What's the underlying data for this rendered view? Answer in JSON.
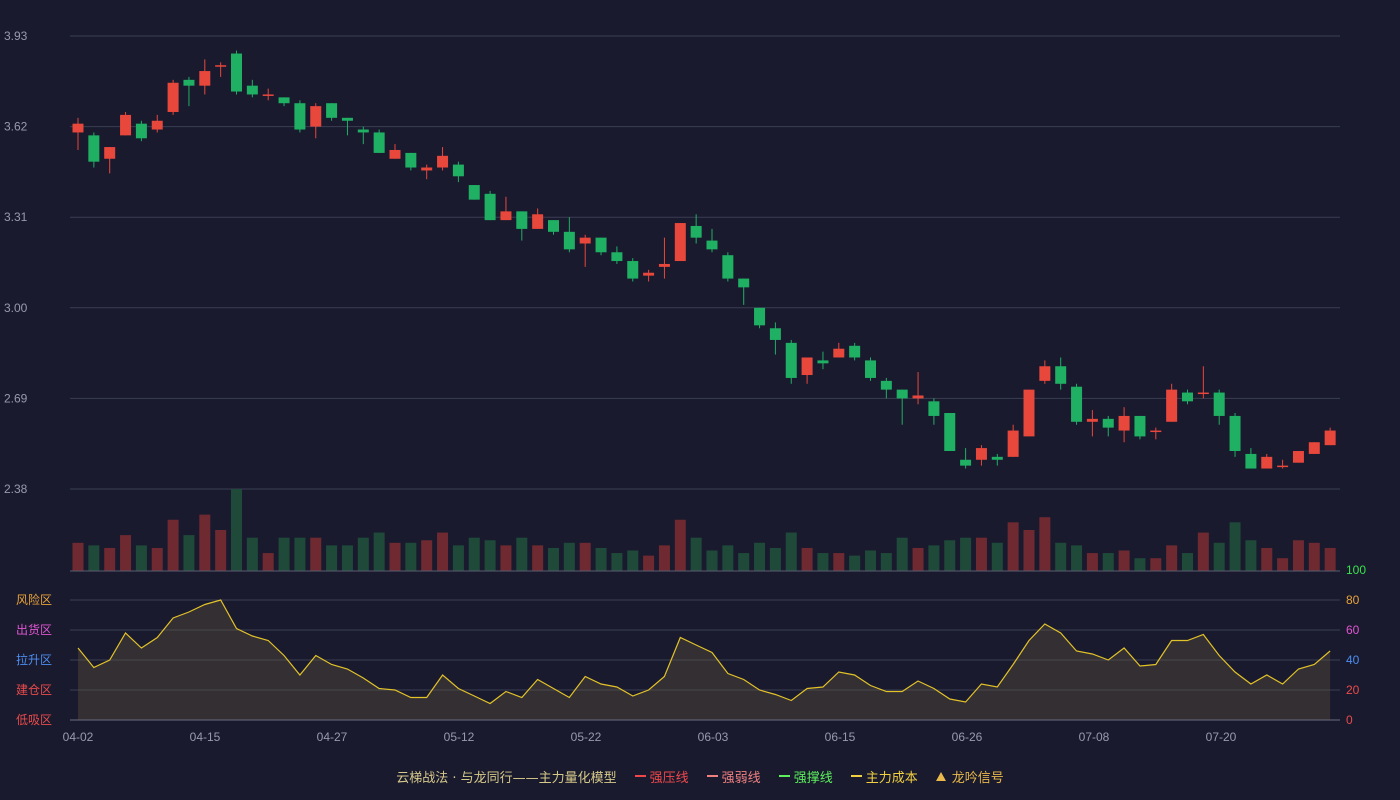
{
  "chart_data": [
    {
      "type": "candlestick",
      "ylim": [
        2.38,
        3.93
      ],
      "y_ticks": [
        "3.93",
        "3.62",
        "3.31",
        "3.00",
        "2.69",
        "2.38"
      ],
      "grid": true,
      "up_color": "#e8473c",
      "down_color": "#20b064",
      "ohlc": [
        [
          3.6,
          3.63,
          3.54,
          3.65
        ],
        [
          3.59,
          3.5,
          3.48,
          3.6
        ],
        [
          3.51,
          3.55,
          3.46,
          3.55
        ],
        [
          3.59,
          3.66,
          3.59,
          3.67
        ],
        [
          3.63,
          3.58,
          3.57,
          3.64
        ],
        [
          3.61,
          3.64,
          3.6,
          3.66
        ],
        [
          3.67,
          3.77,
          3.66,
          3.78
        ],
        [
          3.78,
          3.76,
          3.69,
          3.79
        ],
        [
          3.76,
          3.81,
          3.73,
          3.85
        ],
        [
          3.83,
          3.83,
          3.79,
          3.84
        ],
        [
          3.87,
          3.74,
          3.73,
          3.88
        ],
        [
          3.76,
          3.73,
          3.72,
          3.78
        ],
        [
          3.73,
          3.73,
          3.71,
          3.75
        ],
        [
          3.72,
          3.7,
          3.69,
          3.72
        ],
        [
          3.7,
          3.61,
          3.6,
          3.71
        ],
        [
          3.62,
          3.69,
          3.58,
          3.7
        ],
        [
          3.7,
          3.65,
          3.64,
          3.7
        ],
        [
          3.65,
          3.64,
          3.59,
          3.65
        ],
        [
          3.61,
          3.6,
          3.56,
          3.62
        ],
        [
          3.6,
          3.53,
          3.53,
          3.61
        ],
        [
          3.51,
          3.54,
          3.51,
          3.56
        ],
        [
          3.53,
          3.48,
          3.47,
          3.53
        ],
        [
          3.47,
          3.48,
          3.44,
          3.49
        ],
        [
          3.48,
          3.52,
          3.47,
          3.55
        ],
        [
          3.49,
          3.45,
          3.43,
          3.5
        ],
        [
          3.42,
          3.37,
          3.37,
          3.42
        ],
        [
          3.39,
          3.3,
          3.3,
          3.4
        ],
        [
          3.3,
          3.33,
          3.3,
          3.38
        ],
        [
          3.33,
          3.27,
          3.23,
          3.33
        ],
        [
          3.27,
          3.32,
          3.27,
          3.34
        ],
        [
          3.3,
          3.26,
          3.25,
          3.3
        ],
        [
          3.26,
          3.2,
          3.19,
          3.31
        ],
        [
          3.22,
          3.24,
          3.14,
          3.25
        ],
        [
          3.24,
          3.19,
          3.18,
          3.24
        ],
        [
          3.19,
          3.16,
          3.15,
          3.21
        ],
        [
          3.16,
          3.1,
          3.09,
          3.17
        ],
        [
          3.11,
          3.12,
          3.09,
          3.13
        ],
        [
          3.14,
          3.15,
          3.1,
          3.24
        ],
        [
          3.16,
          3.29,
          3.16,
          3.29
        ],
        [
          3.28,
          3.24,
          3.22,
          3.32
        ],
        [
          3.23,
          3.2,
          3.19,
          3.27
        ],
        [
          3.18,
          3.1,
          3.09,
          3.19
        ],
        [
          3.1,
          3.07,
          3.01,
          3.1
        ],
        [
          3.0,
          2.94,
          2.93,
          3.0
        ],
        [
          2.93,
          2.89,
          2.84,
          2.95
        ],
        [
          2.88,
          2.76,
          2.74,
          2.89
        ],
        [
          2.77,
          2.83,
          2.74,
          2.83
        ],
        [
          2.82,
          2.81,
          2.79,
          2.85
        ],
        [
          2.83,
          2.86,
          2.83,
          2.88
        ],
        [
          2.87,
          2.83,
          2.82,
          2.88
        ],
        [
          2.82,
          2.76,
          2.75,
          2.83
        ],
        [
          2.75,
          2.72,
          2.69,
          2.76
        ],
        [
          2.72,
          2.69,
          2.6,
          2.72
        ],
        [
          2.69,
          2.7,
          2.67,
          2.78
        ],
        [
          2.68,
          2.63,
          2.6,
          2.69
        ],
        [
          2.64,
          2.51,
          2.51,
          2.64
        ],
        [
          2.48,
          2.46,
          2.45,
          2.52
        ],
        [
          2.48,
          2.52,
          2.46,
          2.53
        ],
        [
          2.49,
          2.48,
          2.46,
          2.5
        ],
        [
          2.49,
          2.58,
          2.49,
          2.6
        ],
        [
          2.56,
          2.72,
          2.56,
          2.72
        ],
        [
          2.75,
          2.8,
          2.74,
          2.82
        ],
        [
          2.8,
          2.74,
          2.72,
          2.83
        ],
        [
          2.73,
          2.61,
          2.6,
          2.74
        ],
        [
          2.61,
          2.62,
          2.56,
          2.65
        ],
        [
          2.62,
          2.59,
          2.56,
          2.63
        ],
        [
          2.58,
          2.63,
          2.54,
          2.66
        ],
        [
          2.63,
          2.56,
          2.55,
          2.63
        ],
        [
          2.58,
          2.58,
          2.55,
          2.59
        ],
        [
          2.61,
          2.72,
          2.61,
          2.74
        ],
        [
          2.71,
          2.68,
          2.67,
          2.72
        ],
        [
          2.71,
          2.71,
          2.69,
          2.8
        ],
        [
          2.71,
          2.63,
          2.6,
          2.72
        ],
        [
          2.63,
          2.51,
          2.49,
          2.64
        ],
        [
          2.5,
          2.45,
          2.45,
          2.52
        ],
        [
          2.45,
          2.49,
          2.45,
          2.5
        ],
        [
          2.46,
          2.46,
          2.45,
          2.48
        ],
        [
          2.47,
          2.51,
          2.47,
          2.51
        ],
        [
          2.5,
          2.54,
          2.5,
          2.54
        ],
        [
          2.53,
          2.58,
          2.53,
          2.59
        ]
      ],
      "volume": [
        11,
        10,
        9,
        14,
        10,
        9,
        20,
        14,
        22,
        16,
        32,
        13,
        7,
        13,
        13,
        13,
        10,
        10,
        13,
        15,
        11,
        11,
        12,
        15,
        10,
        13,
        12,
        10,
        13,
        10,
        9,
        11,
        11,
        9,
        7,
        8,
        6,
        10,
        20,
        13,
        8,
        10,
        7,
        11,
        9,
        15,
        9,
        7,
        7,
        6,
        8,
        7,
        13,
        9,
        10,
        12,
        13,
        13,
        11,
        19,
        16,
        21,
        11,
        10,
        7,
        7,
        8,
        5,
        5,
        10,
        7,
        15,
        11,
        19,
        12,
        9,
        5,
        12,
        11,
        9
      ]
    },
    {
      "type": "line",
      "ylim": [
        0,
        100
      ],
      "y_ticks": [
        "100",
        "80",
        "60",
        "40",
        "20",
        "0"
      ],
      "zone_labels": [
        "风险区",
        "出货区",
        "拉升区",
        "建仓区",
        "低吸区"
      ],
      "zone_colors": [
        "#e9a33a",
        "#e055d2",
        "#4d8df0",
        "#ea4b4b",
        "#ea4b4b"
      ],
      "tick_colors": [
        "#38e34b",
        "#e9a33a",
        "#e055d2",
        "#4d8df0",
        "#ea4b4b",
        "#ea4b4b"
      ],
      "x_ticks": [
        "04-02",
        "04-15",
        "04-27",
        "05-12",
        "05-22",
        "06-03",
        "06-15",
        "06-26",
        "07-08",
        "07-20"
      ],
      "line_color": "#e2c229",
      "values": [
        48,
        35,
        40,
        58,
        48,
        55,
        68,
        72,
        77,
        80,
        61,
        56,
        53,
        43,
        30,
        43,
        37,
        34,
        28,
        21,
        20,
        15,
        15,
        30,
        21,
        16,
        11,
        19,
        15,
        27,
        21,
        15,
        29,
        24,
        22,
        16,
        20,
        29,
        55,
        50,
        45,
        31,
        27,
        20,
        17,
        13,
        21,
        22,
        32,
        30,
        23,
        19,
        19,
        26,
        21,
        14,
        12,
        24,
        22,
        37,
        53,
        64,
        58,
        46,
        44,
        40,
        48,
        36,
        37,
        53,
        53,
        57,
        43,
        32,
        24,
        30,
        24,
        34,
        37,
        46
      ]
    }
  ],
  "legend": {
    "title": "云梯战法 · 与龙同行——主力量化模型",
    "items": [
      {
        "label": "强压线",
        "color": "#f0484a",
        "style": "solid"
      },
      {
        "label": "强弱线",
        "color": "#f08080",
        "style": "dashed"
      },
      {
        "label": "强撑线",
        "color": "#5cf05c",
        "style": "solid"
      },
      {
        "label": "主力成本",
        "color": "#f0d040",
        "style": "dashed"
      },
      {
        "label": "龙吟信号",
        "color": "#e8b84a",
        "style": "triangle"
      }
    ]
  }
}
